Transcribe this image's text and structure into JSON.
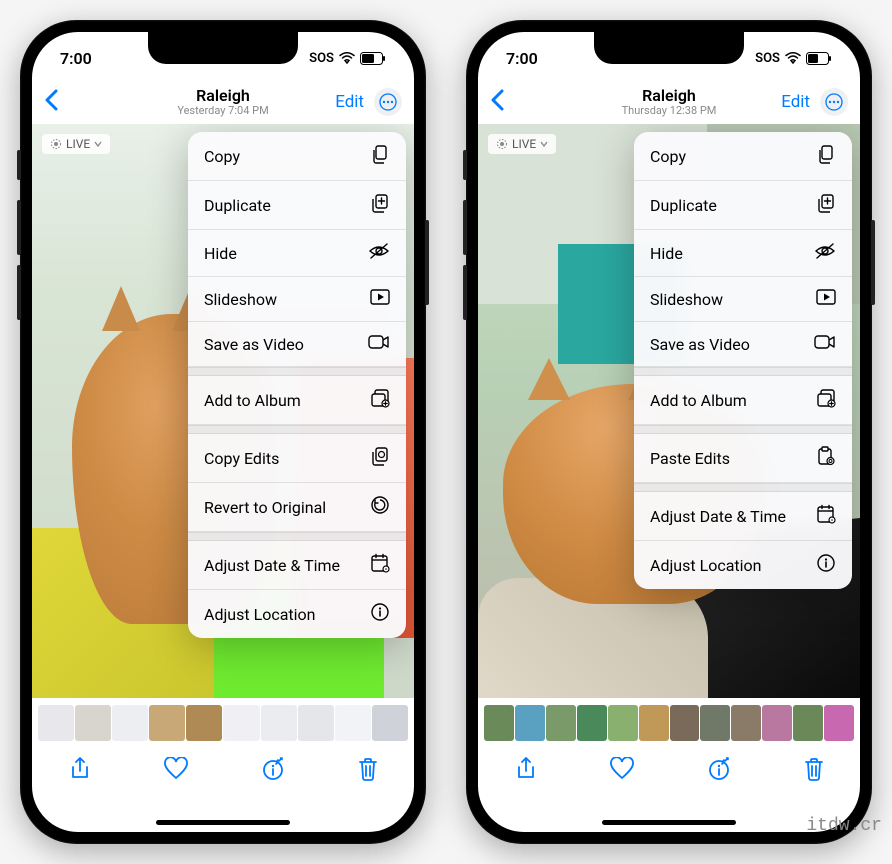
{
  "phones": {
    "left": {
      "status": {
        "time": "7:00",
        "sos": "SOS"
      },
      "nav": {
        "title": "Raleigh",
        "subtitle": "Yesterday 7:04 PM",
        "edit": "Edit"
      },
      "live_badge": "LIVE",
      "menu": {
        "group1": [
          {
            "label": "Copy",
            "icon": "copy-icon"
          },
          {
            "label": "Duplicate",
            "icon": "duplicate-icon"
          },
          {
            "label": "Hide",
            "icon": "eye-slash-icon"
          },
          {
            "label": "Slideshow",
            "icon": "play-rect-icon"
          },
          {
            "label": "Save as Video",
            "icon": "video-icon"
          }
        ],
        "group2": [
          {
            "label": "Add to Album",
            "icon": "album-add-icon"
          }
        ],
        "group3": [
          {
            "label": "Copy Edits",
            "icon": "copy-edits-icon"
          },
          {
            "label": "Revert to Original",
            "icon": "revert-icon"
          }
        ],
        "group4": [
          {
            "label": "Adjust Date & Time",
            "icon": "calendar-icon"
          },
          {
            "label": "Adjust Location",
            "icon": "location-info-icon"
          }
        ]
      }
    },
    "right": {
      "status": {
        "time": "7:00",
        "sos": "SOS"
      },
      "nav": {
        "title": "Raleigh",
        "subtitle": "Thursday 12:38 PM",
        "edit": "Edit"
      },
      "live_badge": "LIVE",
      "menu": {
        "group1": [
          {
            "label": "Copy",
            "icon": "copy-icon"
          },
          {
            "label": "Duplicate",
            "icon": "duplicate-icon"
          },
          {
            "label": "Hide",
            "icon": "eye-slash-icon"
          },
          {
            "label": "Slideshow",
            "icon": "play-rect-icon"
          },
          {
            "label": "Save as Video",
            "icon": "video-icon"
          }
        ],
        "group2": [
          {
            "label": "Add to Album",
            "icon": "album-add-icon"
          }
        ],
        "group3": [
          {
            "label": "Paste Edits",
            "icon": "paste-edits-icon"
          }
        ],
        "group4": [
          {
            "label": "Adjust Date & Time",
            "icon": "calendar-icon"
          },
          {
            "label": "Adjust Location",
            "icon": "location-info-icon"
          }
        ]
      }
    }
  },
  "watermark": "itdw.cr"
}
